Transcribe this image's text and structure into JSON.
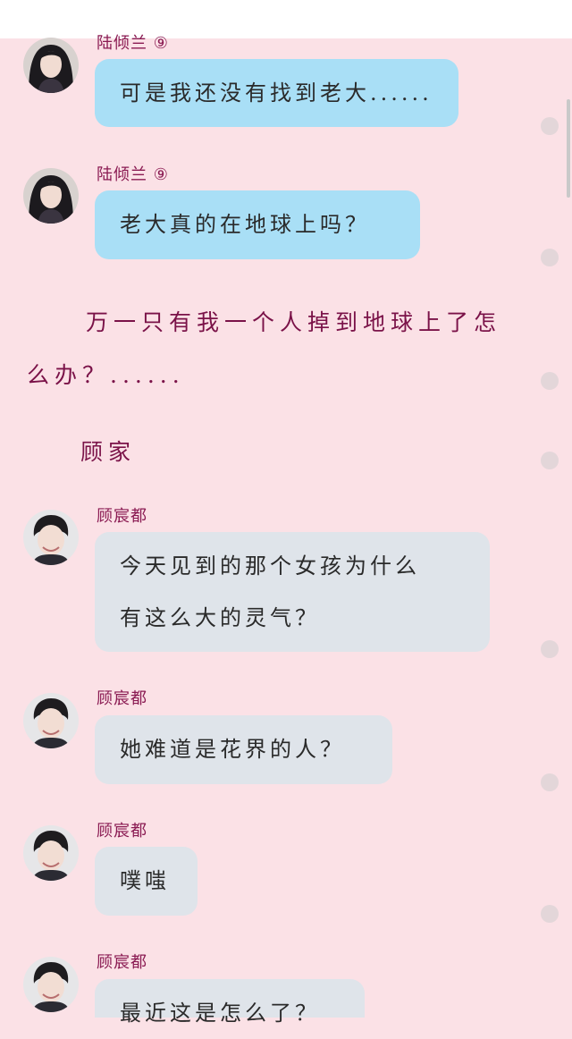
{
  "messages": [
    {
      "speaker": "陆倾兰 ⑨",
      "lines": [
        "可是我还没有找到老大......"
      ]
    },
    {
      "speaker": "陆倾兰 ⑨",
      "lines": [
        "老大真的在地球上吗？"
      ]
    },
    {
      "speaker": "顾宸都",
      "lines": [
        "今天见到的那个女孩为什么",
        "有这么大的灵气？"
      ]
    },
    {
      "speaker": "顾宸都",
      "lines": [
        "她难道是花界的人？"
      ]
    },
    {
      "speaker": "顾宸都",
      "lines": [
        "噗嗤"
      ]
    },
    {
      "speaker": "顾宸都",
      "lines": [
        "最近这是怎么了？"
      ]
    }
  ],
  "narration": {
    "line1": "万一只有我一个人掉到地球上了怎",
    "line2": "么办？......"
  },
  "scene_label": "顾家",
  "colors": {
    "background": "#fbe1e6",
    "female_bubble": "#a9dff6",
    "male_bubble": "#dfe4ea",
    "name_text": "#8a1a52",
    "narration_text": "#7a1248"
  }
}
